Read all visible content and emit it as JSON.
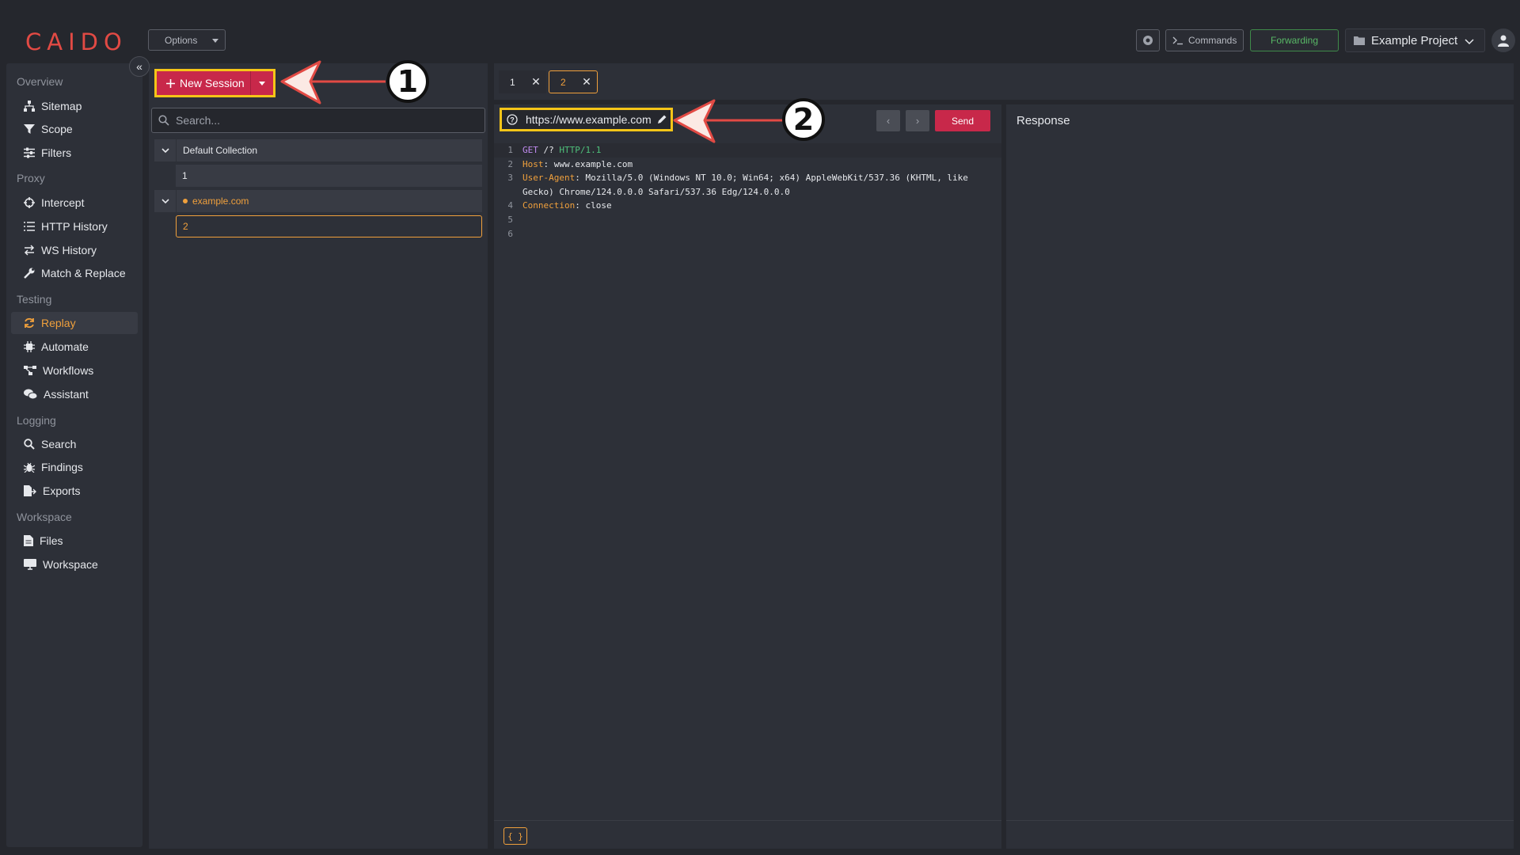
{
  "app": {
    "logo": "CAIDO"
  },
  "topbar": {
    "options_label": "Options",
    "commands_label": "Commands",
    "forwarding_label": "Forwarding",
    "project_label": "Example Project"
  },
  "sidebar": {
    "sections": [
      {
        "title": "Overview",
        "items": [
          "Sitemap",
          "Scope",
          "Filters"
        ]
      },
      {
        "title": "Proxy",
        "items": [
          "Intercept",
          "HTTP History",
          "WS History",
          "Match & Replace"
        ]
      },
      {
        "title": "Testing",
        "items": [
          "Replay",
          "Automate",
          "Workflows",
          "Assistant"
        ]
      },
      {
        "title": "Logging",
        "items": [
          "Search",
          "Findings",
          "Exports"
        ]
      },
      {
        "title": "Workspace",
        "items": [
          "Files",
          "Workspace"
        ]
      }
    ],
    "active_item": "Replay"
  },
  "sessions": {
    "new_session_label": "New Session",
    "search_placeholder": "Search...",
    "collections": [
      {
        "name": "Default Collection",
        "sessions": [
          "1"
        ]
      },
      {
        "name": "example.com",
        "sessions": [
          "2"
        ]
      }
    ],
    "selected_session": "2"
  },
  "tabs": [
    {
      "label": "1",
      "active": false
    },
    {
      "label": "2",
      "active": true
    }
  ],
  "request": {
    "url": "https://www.example.com",
    "send_label": "Send",
    "format_label": "{ }",
    "lines": [
      {
        "n": "1",
        "method": "GET",
        "path": " /? ",
        "version": "HTTP/1.1"
      },
      {
        "n": "2",
        "name": "Host",
        "value": ": www.example.com"
      },
      {
        "n": "3",
        "name": "User-Agent",
        "value": ": Mozilla/5.0 (Windows NT 10.0; Win64; x64) AppleWebKit/537.36 (KHTML, like Gecko) Chrome/124.0.0.0 Safari/537.36 Edg/124.0.0.0"
      },
      {
        "n": "4",
        "name": "Connection",
        "value": ": close"
      },
      {
        "n": "5"
      },
      {
        "n": "6"
      }
    ]
  },
  "response": {
    "title": "Response"
  },
  "annotations": {
    "marker_1": "1",
    "marker_2": "2"
  },
  "colors": {
    "accent": "#f0a03c",
    "primary": "#c8284a",
    "highlight": "#f5c518",
    "forwarding": "#58b866"
  }
}
